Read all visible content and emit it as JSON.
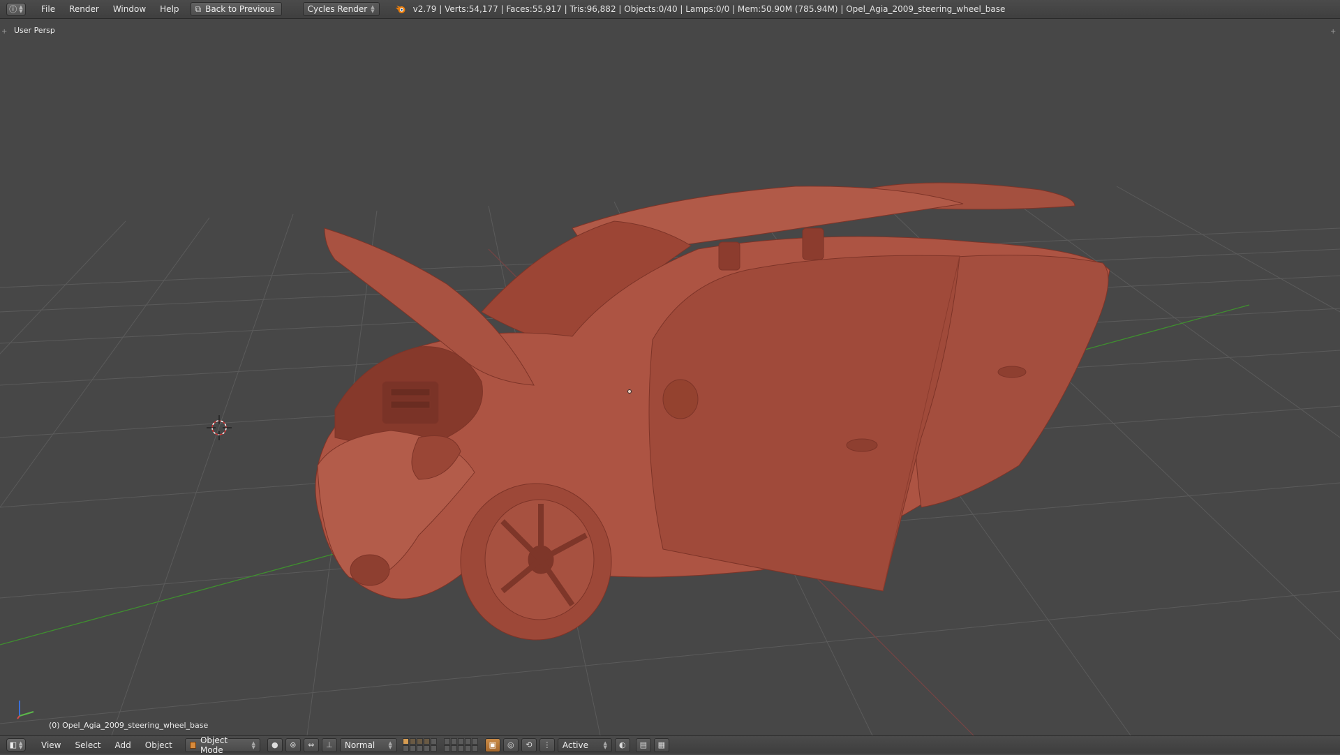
{
  "topbar": {
    "editor_icon": "info-icon",
    "menus": [
      "File",
      "Render",
      "Window",
      "Help"
    ],
    "back_label": "Back to Previous",
    "render_engine": "Cycles Render",
    "stats": "v2.79 | Verts:54,177 | Faces:55,917 | Tris:96,882 | Objects:0/40 | Lamps:0/0 | Mem:50.90M (785.94M) | Opel_Agia_2009_steering_wheel_base"
  },
  "viewport": {
    "view_name": "User Persp",
    "active_object": "(0) Opel_Agia_2009_steering_wheel_base",
    "model_color": "#b05545",
    "background_color": "#474747",
    "grid_color": "#5b5b5b",
    "x_axis_color": "#9a4040",
    "y_axis_color": "#3f8f2f"
  },
  "bottombar": {
    "menus": [
      "View",
      "Select",
      "Add",
      "Object"
    ],
    "mode": "Object Mode",
    "orientation": "Normal",
    "pivot": "Active"
  }
}
